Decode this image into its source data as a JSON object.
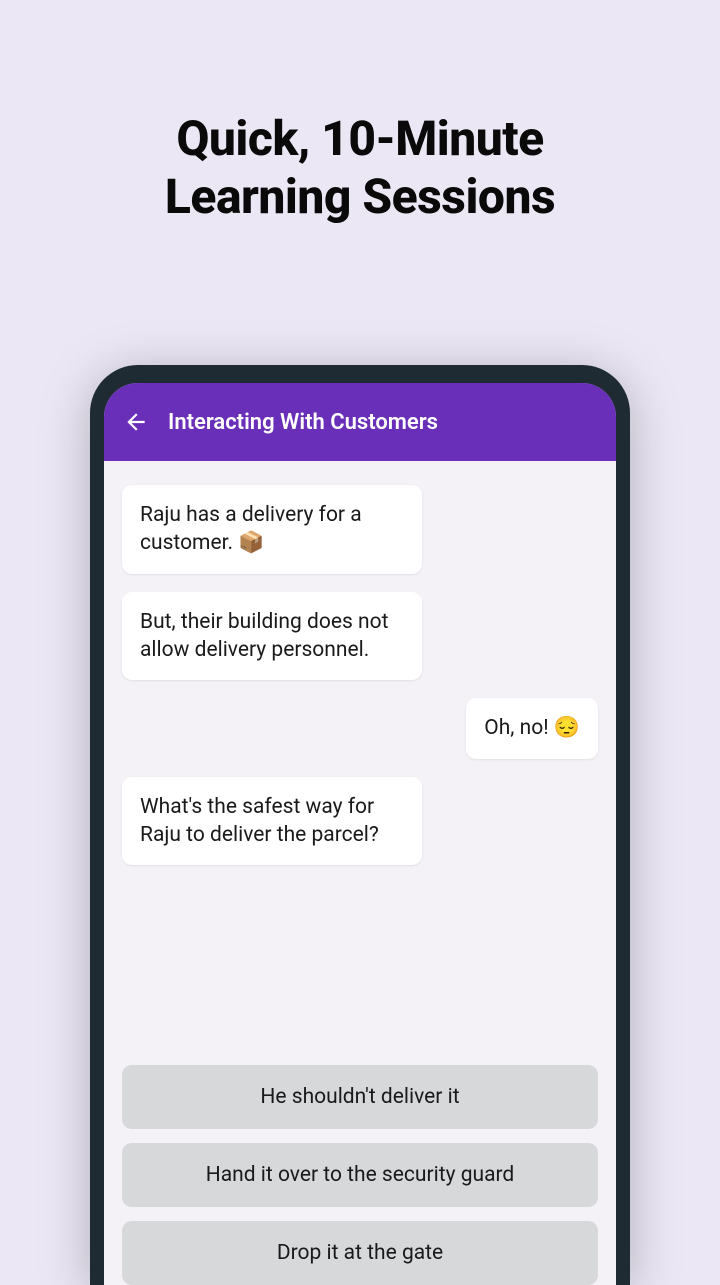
{
  "promo": {
    "title_line1": "Quick, 10-Minute",
    "title_line2": "Learning Sessions"
  },
  "header": {
    "title": "Interacting With Customers"
  },
  "chat": {
    "msg1": "Raju has a delivery for a customer. 📦",
    "msg2": "But, their building does not allow delivery personnel.",
    "msg3": "Oh, no! 😔",
    "msg4": "What's the safest way for Raju to deliver the parcel?"
  },
  "answers": {
    "opt1": "He shouldn't deliver it",
    "opt2": "Hand it over to the security guard",
    "opt3": "Drop it at the gate"
  }
}
